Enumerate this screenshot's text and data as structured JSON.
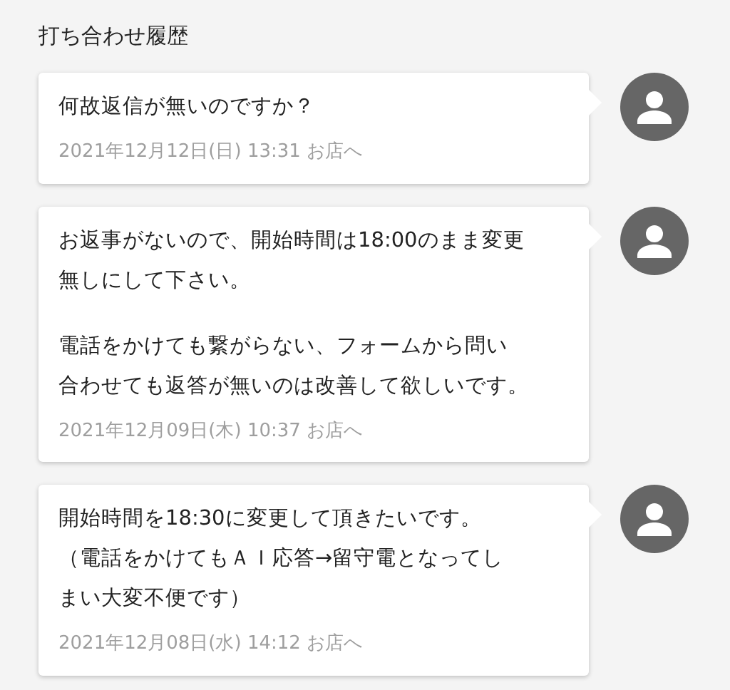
{
  "title": "打ち合わせ履歴",
  "messages": [
    {
      "paragraphs": [
        [
          "何故返信が無いのですか？"
        ]
      ],
      "meta": "2021年12月12日(日) 13:31 お店へ"
    },
    {
      "paragraphs": [
        [
          "お返事がないので、開始時間は18:00のまま変更",
          "無しにして下さい。"
        ],
        [
          "電話をかけても繋がらない、フォームから問い",
          "合わせても返答が無いのは改善して欲しいです。"
        ]
      ],
      "meta": "2021年12月09日(木) 10:37 お店へ"
    },
    {
      "paragraphs": [
        [
          "開始時間を18:30に変更して頂きたいです。",
          "（電話をかけてもＡＩ応答→留守電となってし",
          "まい大変不便です）"
        ]
      ],
      "meta": "2021年12月08日(水) 14:12 お店へ"
    }
  ]
}
